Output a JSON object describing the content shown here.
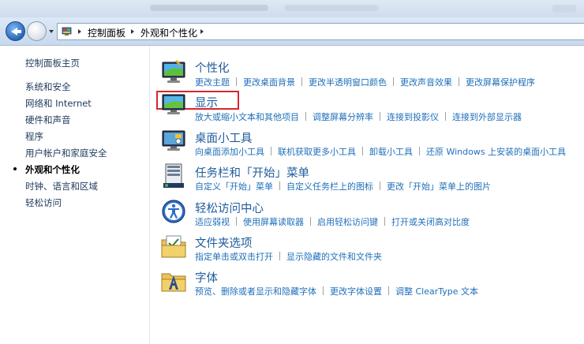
{
  "address_bar": {
    "breadcrumbs": [
      "控制面板",
      "外观和个性化"
    ]
  },
  "sidebar": {
    "items": [
      {
        "label": "控制面板主页",
        "current": false
      },
      {
        "label": "系统和安全",
        "current": false
      },
      {
        "label": "网络和 Internet",
        "current": false
      },
      {
        "label": "硬件和声音",
        "current": false
      },
      {
        "label": "程序",
        "current": false
      },
      {
        "label": "用户帐户和家庭安全",
        "current": false
      },
      {
        "label": "外观和个性化",
        "current": true
      },
      {
        "label": "时钟、语言和区域",
        "current": false
      },
      {
        "label": "轻松访问",
        "current": false
      }
    ]
  },
  "categories": [
    {
      "title": "个性化",
      "icon": "personalization-icon",
      "links": [
        "更改主题",
        "更改桌面背景",
        "更改半透明窗口颜色",
        "更改声音效果",
        "更改屏幕保护程序"
      ]
    },
    {
      "title": "显示",
      "icon": "display-icon",
      "highlighted": true,
      "links": [
        "放大或缩小文本和其他项目",
        "调整屏幕分辨率",
        "连接到投影仪",
        "连接到外部显示器"
      ]
    },
    {
      "title": "桌面小工具",
      "icon": "gadgets-icon",
      "links": [
        "向桌面添加小工具",
        "联机获取更多小工具",
        "卸载小工具",
        "还原 Windows 上安装的桌面小工具"
      ]
    },
    {
      "title": "任务栏和「开始」菜单",
      "icon": "taskbar-icon",
      "links": [
        "自定义「开始」菜单",
        "自定义任务栏上的图标",
        "更改「开始」菜单上的图片"
      ]
    },
    {
      "title": "轻松访问中心",
      "icon": "ease-of-access-icon",
      "links": [
        "适应弱视",
        "使用屏幕读取器",
        "启用轻松访问键",
        "打开或关闭高对比度"
      ]
    },
    {
      "title": "文件夹选项",
      "icon": "folder-options-icon",
      "links": [
        "指定单击或双击打开",
        "显示隐藏的文件和文件夹"
      ]
    },
    {
      "title": "字体",
      "icon": "fonts-icon",
      "links": [
        "预览、删除或者显示和隐藏字体",
        "更改字体设置",
        "调整 ClearType 文本"
      ]
    }
  ],
  "colors": {
    "link": "#1f6fba",
    "category_title": "#1e5c9b",
    "highlight": "#d9262b",
    "navbar": "#c8d9ee"
  }
}
